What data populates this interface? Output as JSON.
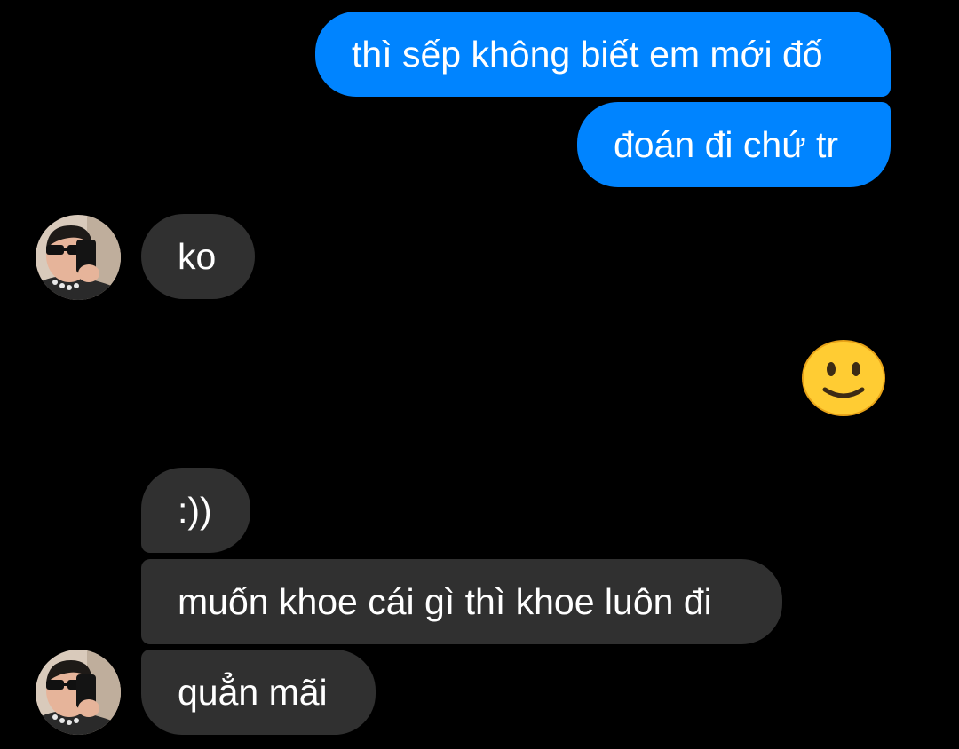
{
  "conversation": {
    "messages": [
      {
        "direction": "outgoing",
        "text": "thì sếp không biết em mới đố"
      },
      {
        "direction": "outgoing",
        "text": "đoán đi chứ tr"
      },
      {
        "direction": "incoming",
        "text": "ko"
      },
      {
        "direction": "outgoing",
        "type": "emoji",
        "emoji": "slightly-smiling-face"
      },
      {
        "direction": "incoming",
        "text": ":))"
      },
      {
        "direction": "incoming",
        "text": "muốn khoe cái gì thì khoe luôn đi"
      },
      {
        "direction": "incoming",
        "text": "quẳn mãi"
      }
    ]
  },
  "colors": {
    "background": "#000000",
    "outgoing_bubble": "#0084ff",
    "incoming_bubble": "#303030",
    "text": "#ffffff",
    "emoji_face": "#ffcc33"
  },
  "icons": {
    "avatar": "contact-avatar",
    "emoji": "slightly-smiling-face-icon"
  }
}
